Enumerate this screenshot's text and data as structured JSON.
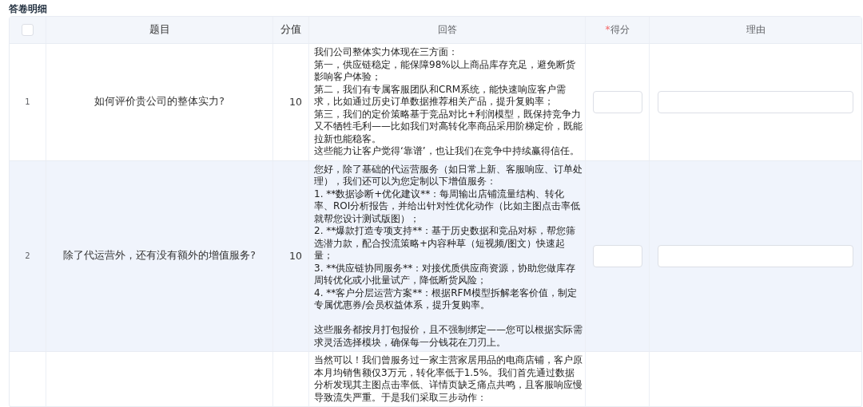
{
  "title": "答卷明细",
  "table": {
    "header_checkbox": {
      "checked": false
    },
    "columns": [
      {
        "label": "题目"
      },
      {
        "label": "分值"
      },
      {
        "label": "回答"
      },
      {
        "label": "得分",
        "mark": "*"
      },
      {
        "label": "理由"
      }
    ],
    "rows": [
      {
        "index": "1",
        "question": "如何评价贵公司的整体实力?",
        "score": "10",
        "hovered": false,
        "inputs": true,
        "answer": [
          {
            "text": "我们公司整体实力体现在三方面："
          },
          {
            "text": "第一，供应链稳定，能保障98%以上商品库存充足，避免断货影响客户体验；"
          },
          {
            "text": "第二，我们有专属客服团队和CRM系统，能快速响应客户需求，比如通过历史订单数据推荐相关产品，提升复购率；"
          },
          {
            "text": "第三，我们的定价策略基于竞品对比+利润模型，既保持竞争力又不牺牲毛利——比如我们对高转化率商品采用阶梯定价，既能拉新也能稳客。"
          },
          {
            "text": "这些能力让客户觉得‘靠谱’，也让我们在竞争中持续赢得信任。"
          }
        ]
      },
      {
        "index": "2",
        "question": "除了代运营外，还有没有额外的增值服务?",
        "score": "10",
        "hovered": true,
        "inputs": true,
        "answer": [
          {
            "text": "您好，除了基础的代运营服务（如日常上新、客服响应、订单处理），我们还可以为您定制以下增值服务："
          },
          {
            "text": "1. **数据诊断+优化建议**：每周输出店铺流量结构、转化率、ROI分析报告，并给出针对性优化动作（比如主图点击率低就帮您设计测试版图）；"
          },
          {
            "text": "2. **爆款打造专项支持**：基于历史数据和竞品对标，帮您筛选潜力款，配合投流策略+内容种草（短视频/图文）快速起量；"
          },
          {
            "text": "3. **供应链协同服务**：对接优质供应商资源，协助您做库存周转优化或小批量试产，降低断货风险；"
          },
          {
            "text": "4. **客户分层运营方案**：根据RFM模型拆解老客价值，制定专属优惠券/会员权益体系，提升复购率。"
          },
          {
            "text": "这些服务都按月打包报价，且不强制绑定——您可以根据实际需求灵活选择模块，确保每一分钱花在刀刃上。",
            "space_before": true
          }
        ]
      },
      {
        "hovered": false,
        "inputs": false,
        "answer": [
          {
            "text": "当然可以！我们曾服务过一家主营家居用品的电商店铺，客户原本月均销售额仅3万元，转化率低于1.5%。我们首先通过数据分析发现其主图点击率低、详情页缺乏痛点共鸣，且客服响应慢导致流失严重。于是我们采取三步动作："
          }
        ]
      }
    ]
  }
}
